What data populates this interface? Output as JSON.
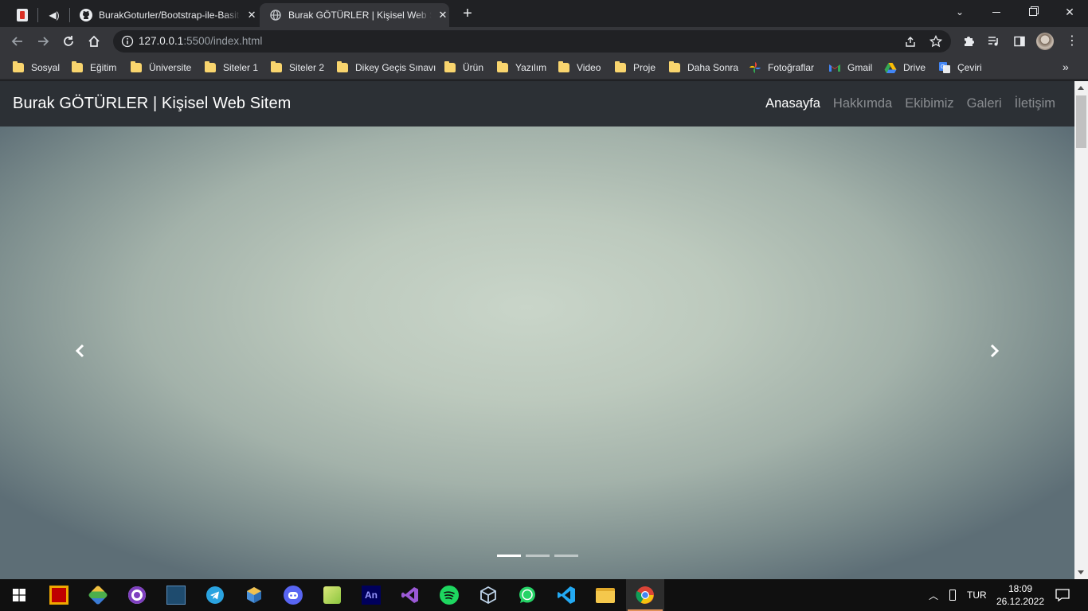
{
  "browser": {
    "tabs": [
      {
        "title": "BurakGoturler/Bootstrap-ile-Basit-Web-Sitesi",
        "active": false
      },
      {
        "title": "Burak GÖTÜRLER | Kişisel Web Sitem",
        "active": true
      }
    ],
    "url_host": "127.0.0.1",
    "url_rest": ":5500/index.html"
  },
  "bookmarks": [
    {
      "label": "Sosyal",
      "icon": "folder-icon"
    },
    {
      "label": "Eğitim",
      "icon": "folder-icon"
    },
    {
      "label": "Üniversite",
      "icon": "folder-icon"
    },
    {
      "label": "Siteler 1",
      "icon": "folder-icon"
    },
    {
      "label": "Siteler 2",
      "icon": "folder-icon"
    },
    {
      "label": "Dikey Geçis Sınavı",
      "icon": "folder-icon"
    },
    {
      "label": "Ürün",
      "icon": "folder-icon"
    },
    {
      "label": "Yazılım",
      "icon": "folder-icon"
    },
    {
      "label": "Video",
      "icon": "folder-icon"
    },
    {
      "label": "Proje",
      "icon": "folder-icon"
    },
    {
      "label": "Daha Sonra",
      "icon": "folder-icon"
    },
    {
      "label": "Fotoğraflar",
      "icon": "google-photos-icon"
    },
    {
      "label": "Gmail",
      "icon": "gmail-icon"
    },
    {
      "label": "Drive",
      "icon": "google-drive-icon"
    },
    {
      "label": "Çeviri",
      "icon": "google-translate-icon"
    }
  ],
  "page": {
    "brand": "Burak GÖTÜRLER | Kişisel Web Sitem",
    "nav": [
      {
        "label": "Anasayfa",
        "active": true
      },
      {
        "label": "Hakkımda",
        "active": false
      },
      {
        "label": "Ekibimiz",
        "active": false
      },
      {
        "label": "Galeri",
        "active": false
      },
      {
        "label": "İletişim",
        "active": false
      }
    ],
    "carousel": {
      "slides": 3,
      "active_slide": 1
    }
  },
  "taskbar": {
    "apps": [
      "filezilla",
      "git",
      "github-desktop",
      "mysql-workbench",
      "telegram",
      "virtualbox-like",
      "discord",
      "notepad-plus",
      "animate",
      "visual-studio",
      "spotify",
      "virtualbox",
      "whatsapp",
      "vscode",
      "file-explorer",
      "chrome"
    ],
    "language": "TUR",
    "time": "18:09",
    "date": "26.12.2022"
  },
  "colors": {
    "navbar": "#2c3035",
    "nav_active": "#ffffff",
    "nav_inactive": "#8a8d91",
    "hero_center": "#c9d5c9",
    "hero_edge": "#5d6e76"
  }
}
